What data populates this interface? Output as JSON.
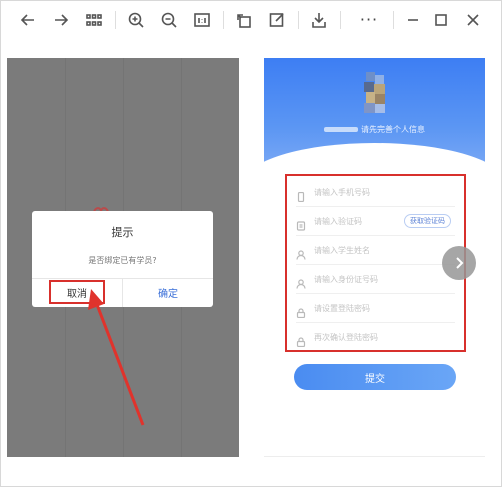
{
  "toolbar": {
    "icons": [
      "back-arrow-icon",
      "forward-arrow-icon",
      "grid-icon",
      "zoom-in-icon",
      "zoom-out-icon",
      "actual-size-icon",
      "rotate-icon",
      "edit-icon",
      "download-icon",
      "more-icon",
      "minimize-icon",
      "maximize-icon",
      "close-icon"
    ],
    "more_label": "···"
  },
  "left_screen": {
    "dialog": {
      "title": "提示",
      "message": "是否绑定已有学员?",
      "cancel_label": "取消",
      "confirm_label": "确定"
    },
    "highlight_color": "#d8302c"
  },
  "right_screen": {
    "banner": {
      "text": "请先完善个人信息",
      "color": "#3d7ef3"
    },
    "fields": [
      {
        "icon": "phone-icon",
        "placeholder": "请输入手机号码"
      },
      {
        "icon": "code-icon",
        "placeholder": "请输入验证码",
        "button": "获取验证码"
      },
      {
        "icon": "user-icon",
        "placeholder": "请输入学生姓名"
      },
      {
        "icon": "user-icon",
        "placeholder": "请输入身份证号码"
      },
      {
        "icon": "lock-icon",
        "placeholder": "请设置登陆密码"
      },
      {
        "icon": "lock-icon",
        "placeholder": "再次确认登陆密码"
      }
    ],
    "submit_label": "提交",
    "next_icon": "chevron-right-icon"
  }
}
